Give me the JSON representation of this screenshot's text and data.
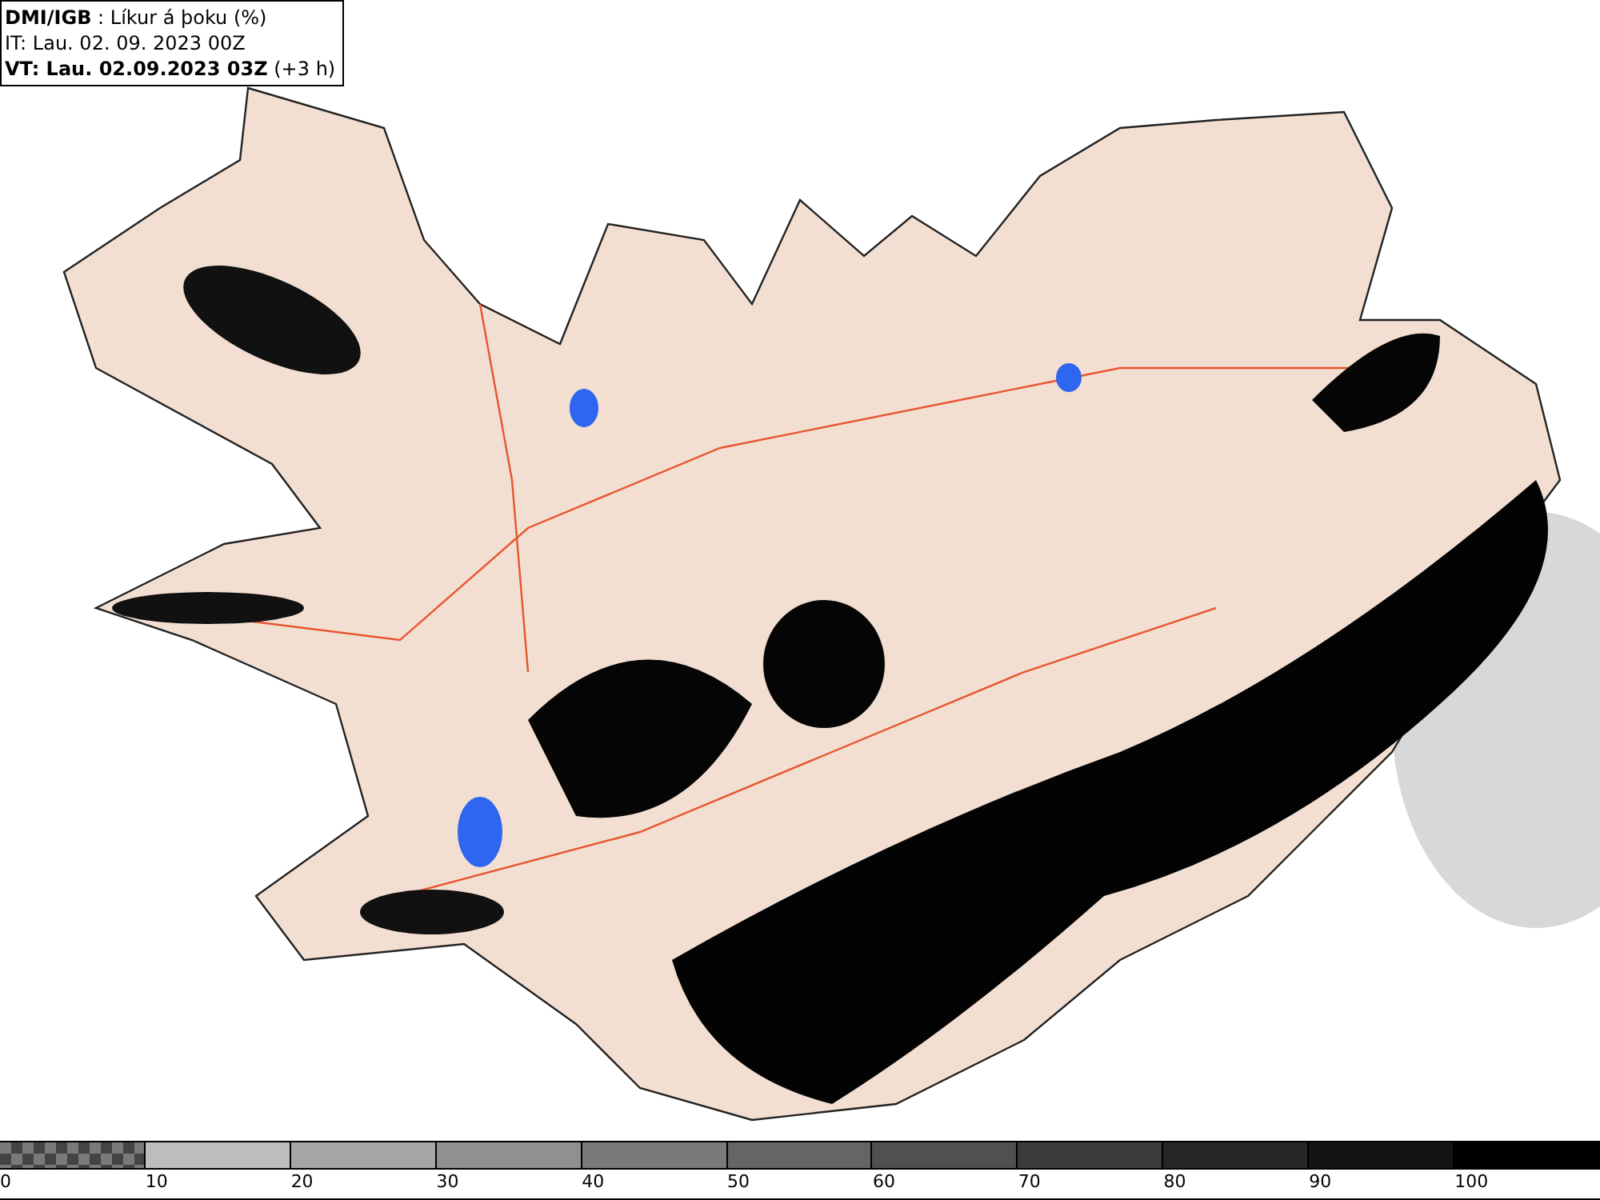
{
  "header": {
    "lines": [
      "**DMI/IGB** : Líkur á þoku (%)",
      "IT: Lau. 02. 09. 2023 00Z",
      "**VT: Lau. 02.09.2023 03Z** (+3 h)"
    ]
  },
  "legend": [
    {
      "label": "0",
      "kind": "checkered"
    },
    {
      "label": "10",
      "kind": "solid",
      "color": "#bdbdbd"
    },
    {
      "label": "20",
      "kind": "solid",
      "color": "#a6a6a6"
    },
    {
      "label": "30",
      "kind": "solid",
      "color": "#909090"
    },
    {
      "label": "40",
      "kind": "solid",
      "color": "#7a7a7a"
    },
    {
      "label": "50",
      "kind": "solid",
      "color": "#656565"
    },
    {
      "label": "60",
      "kind": "solid",
      "color": "#505050"
    },
    {
      "label": "70",
      "kind": "solid",
      "color": "#3b3b3b"
    },
    {
      "label": "80",
      "kind": "solid",
      "color": "#262626"
    },
    {
      "label": "90",
      "kind": "solid",
      "color": "#131313"
    },
    {
      "label": "100",
      "kind": "solid",
      "color": "#000000"
    }
  ]
}
